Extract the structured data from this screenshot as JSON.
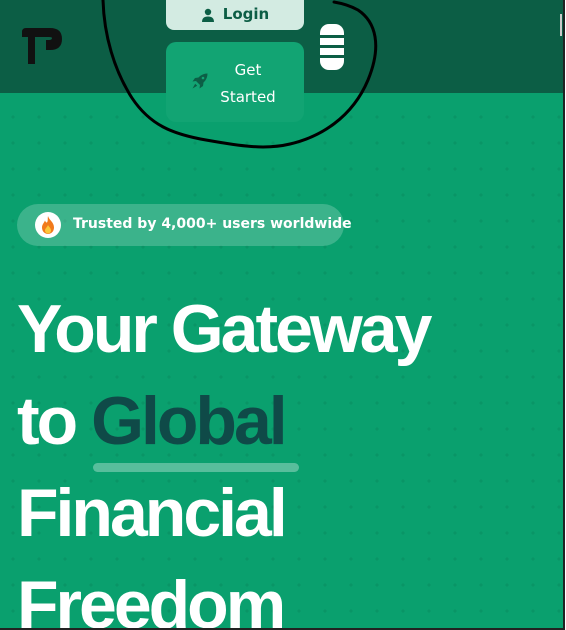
{
  "colors": {
    "hero_background": "#0aa06e",
    "navbar_background": "#0c5e45",
    "accent_text": "#0f4a48",
    "login_background": "#d3ebe2",
    "annotation_ink": "#000000"
  },
  "navbar": {
    "logo": "TP-logo",
    "login": {
      "label": "Login",
      "icon": "user-icon"
    },
    "get_started": {
      "label_line1": "Get",
      "label_line2": "Started",
      "icon": "rocket-icon"
    },
    "menu": {
      "icon": "hamburger-menu-icon"
    }
  },
  "hero": {
    "badge": {
      "icon": "fire-icon",
      "text": "Trusted by 4,000+ users worldwide"
    },
    "headline": {
      "line1": "Your Gateway",
      "line2_prefix": "to",
      "line2_accent": "Global",
      "line3": "Financial",
      "line4": "Freedom"
    }
  }
}
